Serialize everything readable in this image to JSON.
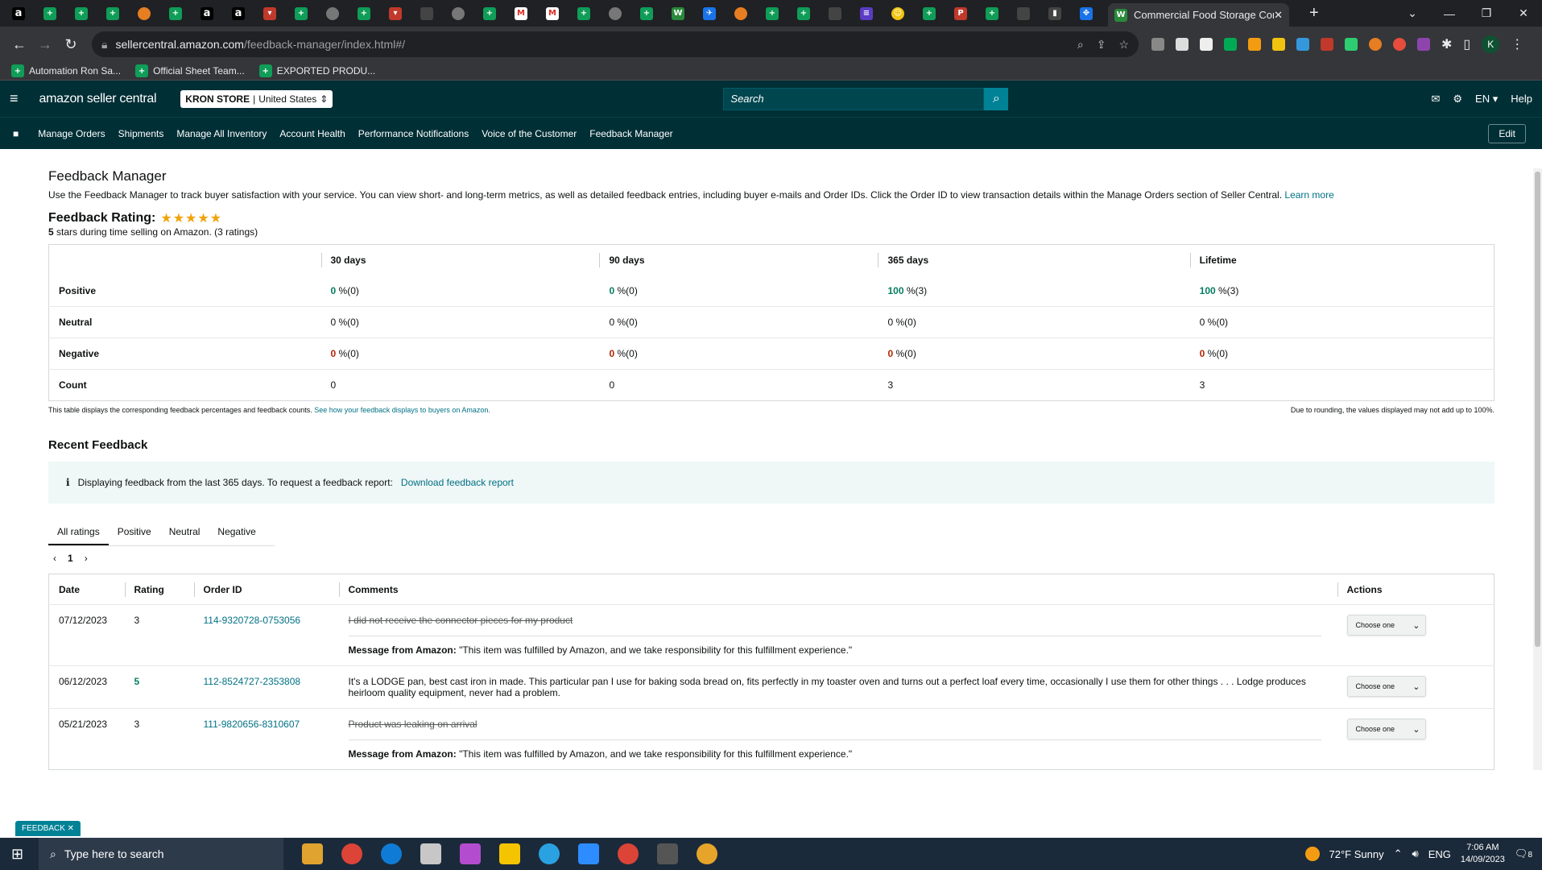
{
  "browser": {
    "active_tab_title": "Commercial Food Storage Conta",
    "url_domain": "sellercentral.amazon.com",
    "url_path": "/feedback-manager/index.html#/",
    "bookmarks": [
      "Automation Ron Sa...",
      "Official Sheet Team...",
      "EXPORTED PRODU..."
    ],
    "profile_initial": "K"
  },
  "header": {
    "logo": "amazon seller central",
    "store_name": "KRON STORE",
    "store_region": "United States",
    "search_placeholder": "Search",
    "lang": "EN",
    "help": "Help"
  },
  "nav": {
    "items": [
      "Manage Orders",
      "Shipments",
      "Manage All Inventory",
      "Account Health",
      "Performance Notifications",
      "Voice of the Customer",
      "Feedback Manager"
    ],
    "edit": "Edit"
  },
  "page": {
    "title": "Feedback Manager",
    "description": "Use the Feedback Manager to track buyer satisfaction with your service. You can view short- and long-term metrics, as well as detailed feedback entries, including buyer e-mails and Order IDs. Click the Order ID to view transaction details within the Manage Orders section of Seller Central.",
    "learn_more": "Learn more",
    "rating_label": "Feedback Rating:",
    "rating_stars": "★★★★★",
    "rating_value": "5",
    "rating_sub": "stars during time selling on Amazon. (3 ratings)"
  },
  "metrics": {
    "columns": [
      "30 days",
      "90 days",
      "365 days",
      "Lifetime"
    ],
    "rows": [
      {
        "label": "Positive",
        "cells": [
          {
            "v": "0",
            "s": " %(0)",
            "c": "green"
          },
          {
            "v": "0",
            "s": " %(0)",
            "c": "green"
          },
          {
            "v": "100",
            "s": " %(3)",
            "c": "green"
          },
          {
            "v": "100",
            "s": " %(3)",
            "c": "green"
          }
        ]
      },
      {
        "label": "Neutral",
        "cells": [
          {
            "v": "0 %(0)",
            "s": "",
            "c": ""
          },
          {
            "v": "0 %(0)",
            "s": "",
            "c": ""
          },
          {
            "v": "0 %(0)",
            "s": "",
            "c": ""
          },
          {
            "v": "0 %(0)",
            "s": "",
            "c": ""
          }
        ]
      },
      {
        "label": "Negative",
        "cells": [
          {
            "v": "0",
            "s": " %(0)",
            "c": "red"
          },
          {
            "v": "0",
            "s": " %(0)",
            "c": "red"
          },
          {
            "v": "0",
            "s": " %(0)",
            "c": "red"
          },
          {
            "v": "0",
            "s": " %(0)",
            "c": "red"
          }
        ]
      },
      {
        "label": "Count",
        "cells": [
          {
            "v": "0",
            "s": "",
            "c": ""
          },
          {
            "v": "0",
            "s": "",
            "c": ""
          },
          {
            "v": "3",
            "s": "",
            "c": ""
          },
          {
            "v": "3",
            "s": "",
            "c": ""
          }
        ]
      }
    ],
    "note_left": "This table displays the corresponding feedback percentages and feedback counts.",
    "note_link": "See how your feedback displays to buyers on Amazon.",
    "note_right": "Due to rounding, the values displayed may not add up to 100%."
  },
  "recent": {
    "title": "Recent Feedback",
    "info": "Displaying feedback from the last 365 days. To request a feedback report:",
    "info_link": "Download feedback report",
    "tabs": [
      "All ratings",
      "Positive",
      "Neutral",
      "Negative"
    ],
    "page": "1",
    "columns": [
      "Date",
      "Rating",
      "Order ID",
      "Comments",
      "Actions"
    ],
    "rows": [
      {
        "date": "07/12/2023",
        "rating": "3",
        "order": "114-9320728-0753056",
        "comment": "I did not receive the connector pieces for my product",
        "strike": true,
        "message": "\"This item was fulfilled by Amazon, and we take responsibility for this fulfillment experience.\"",
        "action": "Choose one"
      },
      {
        "date": "06/12/2023",
        "rating": "5",
        "order": "112-8524727-2353808",
        "comment": "It's a LODGE pan, best cast iron in made. This particular pan I use for baking soda bread on, fits perfectly in my toaster oven and turns out a perfect loaf every time, occasionally I use them for other things . . . Lodge produces heirloom quality equipment, never had a problem.",
        "strike": false,
        "message": "",
        "action": "Choose one"
      },
      {
        "date": "05/21/2023",
        "rating": "3",
        "order": "111-9820656-8310607",
        "comment": "Product was leaking on arrival",
        "strike": true,
        "message": "\"This item was fulfilled by Amazon, and we take responsibility for this fulfillment experience.\"",
        "action": "Choose one"
      }
    ],
    "message_label": "Message from Amazon:"
  },
  "feedback_tab": "FEEDBACK",
  "taskbar": {
    "search": "Type here to search",
    "weather": "72°F  Sunny",
    "lang": "ENG",
    "time": "7:06 AM",
    "date": "14/09/2023",
    "notif": "8"
  }
}
